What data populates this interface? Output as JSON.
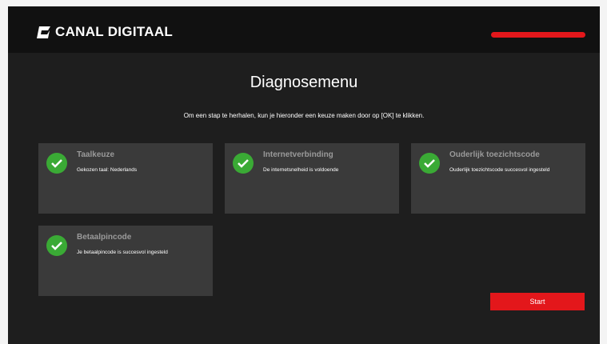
{
  "brand": {
    "name": "CANAL DIGITAAL",
    "logo_icon": "canal-digitaal-logo-icon"
  },
  "header": {
    "accent_color": "#e3171b"
  },
  "page": {
    "title": "Diagnosemenu",
    "instruction": "Om een stap te herhalen, kun je hieronder een keuze maken door op [OK] te klikken."
  },
  "tiles": [
    {
      "title": "Taalkeuze",
      "description": "Gekozen taal: Nederlands",
      "status_icon": "checkmark-icon"
    },
    {
      "title": "Internetverbinding",
      "description": "De internetsnelheid is voldoende",
      "status_icon": "checkmark-icon"
    },
    {
      "title": "Ouderlijk toezichtscode",
      "description": "Ouderlijk toezichtscode succesvol ingesteld",
      "status_icon": "checkmark-icon"
    },
    {
      "title": "Betaalpincode",
      "description": "Je betaalpincode is succesvol ingesteld",
      "status_icon": "checkmark-icon"
    }
  ],
  "actions": {
    "start_label": "Start"
  },
  "colors": {
    "success": "#3aaa35",
    "accent": "#e3171b",
    "tile_bg": "#3a3a3a",
    "background": "#1e1e1e"
  }
}
